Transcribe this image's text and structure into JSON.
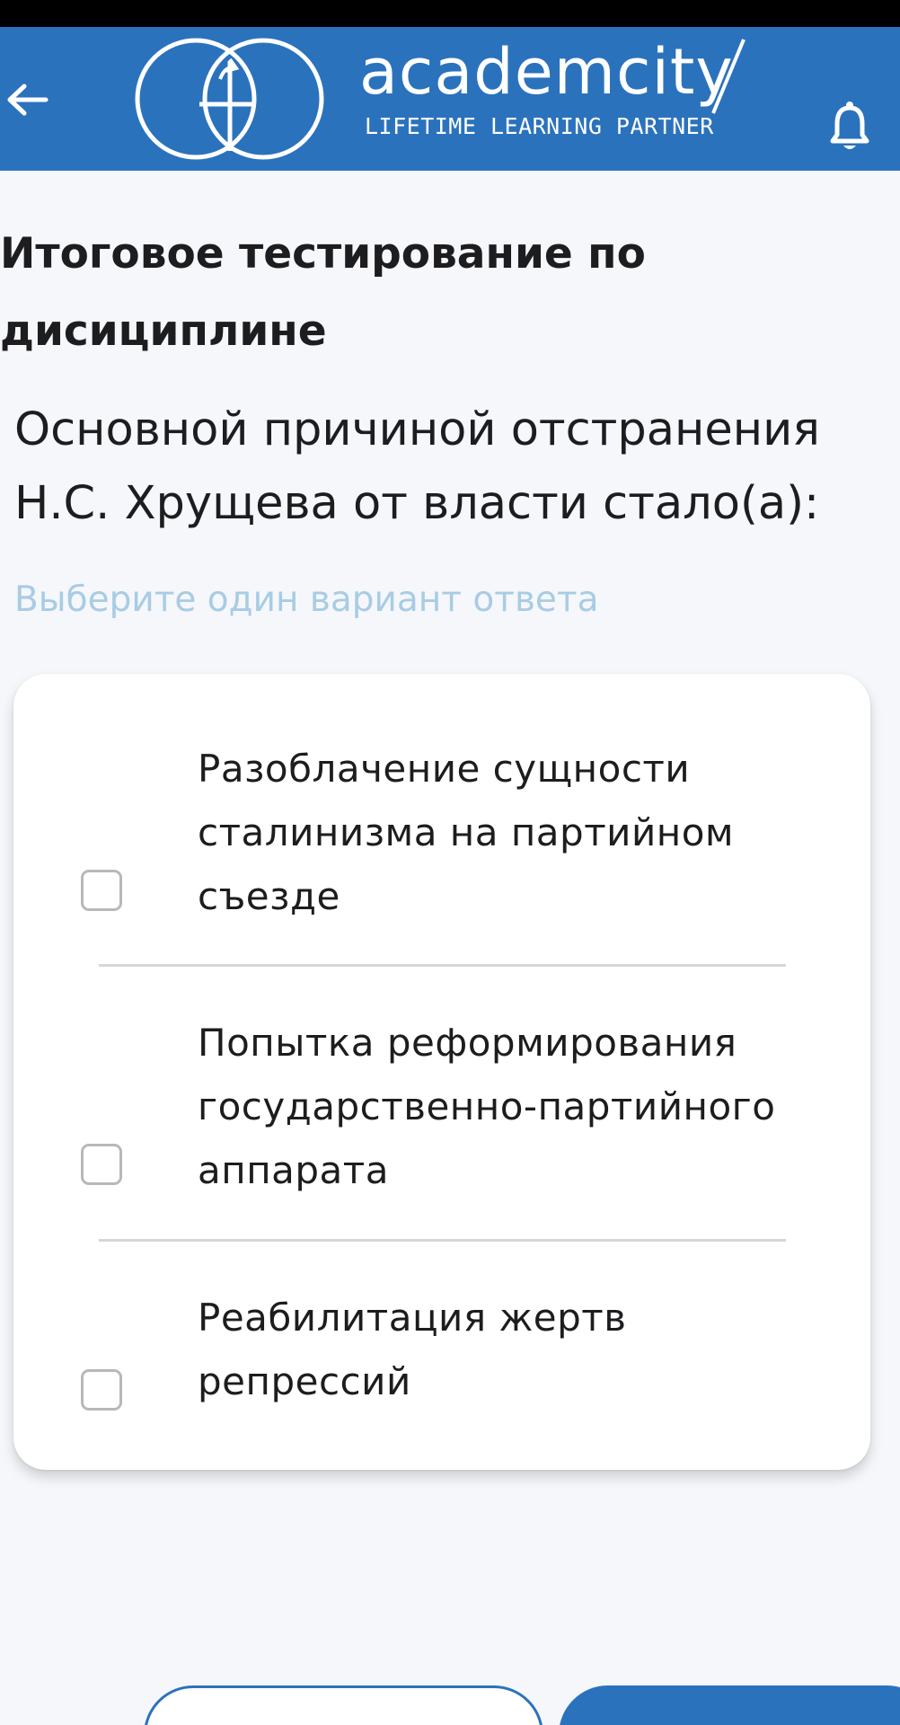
{
  "header": {
    "brand_name": "academcity",
    "tagline": "LIFETIME LEARNING PARTNER",
    "back_icon": "arrow-left-icon",
    "bell_icon": "bell-icon",
    "background_color": "#2b72bd"
  },
  "page": {
    "title": "Итоговое тестирование по дисициплине"
  },
  "question": {
    "text": "Основной причиной отстранения Н.С. Хрущева от власти стало(а):",
    "hint": "Выберите один вариант ответа"
  },
  "options": [
    {
      "label": "Разоблачение сущности сталинизма на партийном съезде",
      "checked": false
    },
    {
      "label": "Попытка реформирования государственно-партийного аппарата",
      "checked": false
    },
    {
      "label": "Реабилитация жертв репрессий",
      "checked": false
    }
  ],
  "colors": {
    "accent": "#2b72bd",
    "hint": "#a8cce4",
    "text": "#1d1d1f",
    "background": "#f5f7fb"
  }
}
